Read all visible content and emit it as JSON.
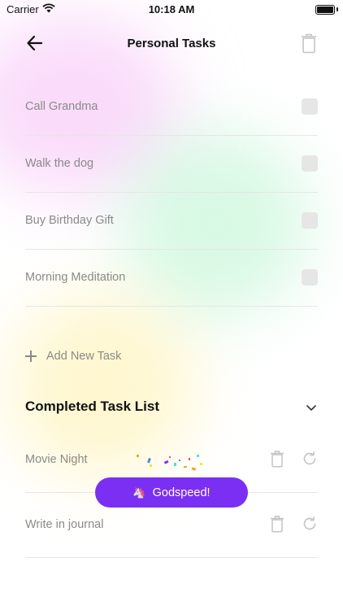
{
  "status_bar": {
    "carrier": "Carrier",
    "time": "10:18 AM"
  },
  "nav": {
    "title": "Personal Tasks"
  },
  "tasks": [
    {
      "label": "Call Grandma"
    },
    {
      "label": "Walk the dog"
    },
    {
      "label": "Buy Birthday Gift"
    },
    {
      "label": "Morning Meditation"
    }
  ],
  "add_task": {
    "label": "Add New Task"
  },
  "completed": {
    "header": "Completed Task List",
    "items": [
      {
        "label": "Movie Night"
      },
      {
        "label": "Write in journal"
      }
    ]
  },
  "toast": {
    "emoji": "🦄",
    "text": "Godspeed!"
  },
  "colors": {
    "accent": "#7b2ff2",
    "muted_text": "#8a8a8a",
    "divider": "#e6e6e6"
  },
  "icons": {
    "back": "arrow-left-icon",
    "delete": "trash-icon",
    "collapse": "chevron-down-icon",
    "restore": "refresh-icon",
    "add": "plus-icon",
    "checkbox": "checkbox-icon"
  }
}
